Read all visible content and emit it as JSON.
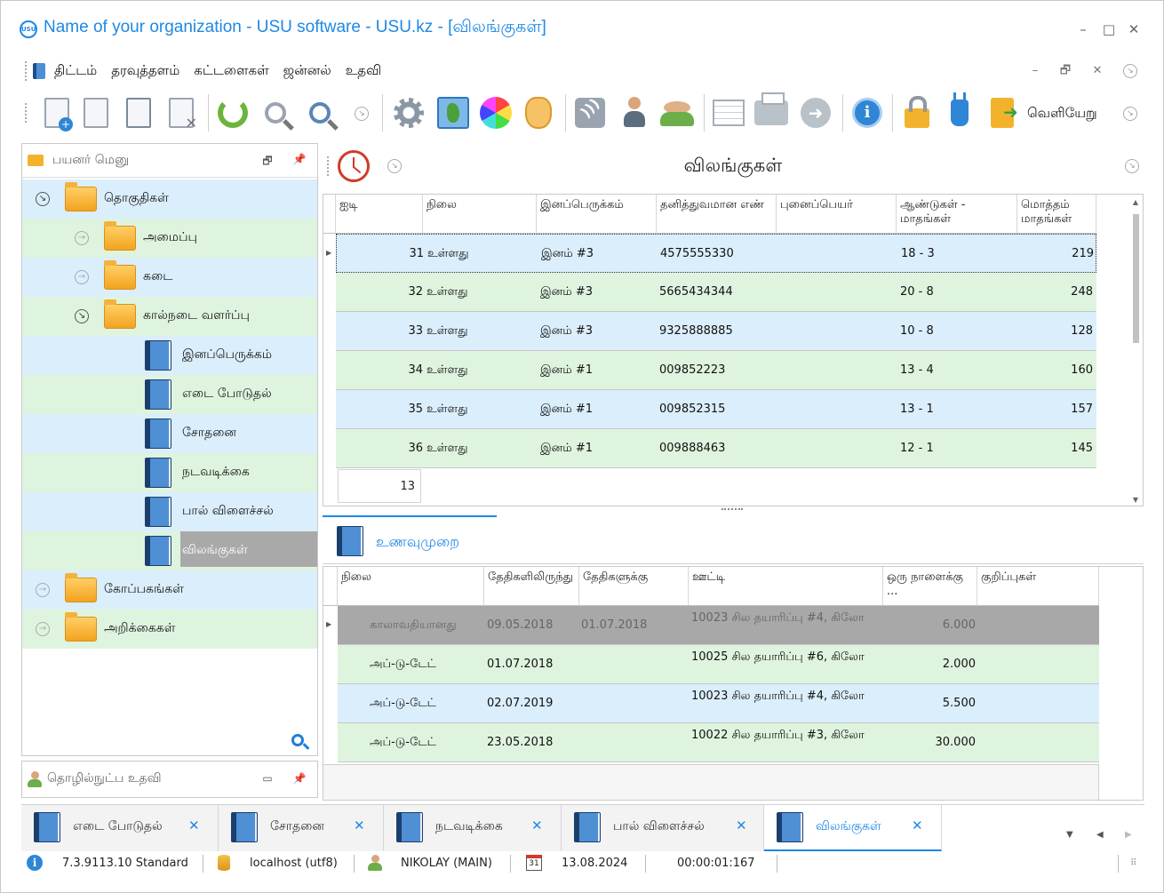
{
  "window": {
    "logo_text": "USU",
    "title": "Name of your organization - USU software - USU.kz - [விலங்குகள்]",
    "minimize": "–",
    "maximize": "□",
    "close": "✕"
  },
  "menu": {
    "items": [
      "திட்டம்",
      "தரவுத்தளம்",
      "கட்டளைகள்",
      "ஜன்னல்",
      "உதவி"
    ],
    "mdi_minimize": "–",
    "mdi_restore": "🗗",
    "mdi_close": "✕"
  },
  "toolbar": {
    "exit_label": "வெளியேறு",
    "icons": [
      "new-document-icon",
      "copy-document-icon",
      "edit-document-icon",
      "delete-document-icon",
      "refresh-icon",
      "search-icon",
      "advanced-search-icon",
      "settings-gear-icon",
      "map-icon",
      "color-wheel-icon",
      "hand-icon",
      "rss-icon",
      "user-key-icon",
      "users-group-icon",
      "table-grid-icon",
      "printer-icon",
      "forward-arrow-icon",
      "info-icon",
      "lock-icon",
      "plug-icon",
      "exit-door-icon"
    ]
  },
  "nav_panel": {
    "title": "பயனர் மெனு",
    "tree": [
      {
        "label": "தொகுதிகள்",
        "level": 0,
        "type": "folder",
        "expanded": true
      },
      {
        "label": "அமைப்பு",
        "level": 1,
        "type": "folder",
        "expanded": false
      },
      {
        "label": "கடை",
        "level": 1,
        "type": "folder",
        "expanded": false
      },
      {
        "label": "கால்நடை வளர்ப்பு",
        "level": 1,
        "type": "folder",
        "expanded": true
      },
      {
        "label": "இனப்பெருக்கம்",
        "level": 2,
        "type": "book"
      },
      {
        "label": "எடை போடுதல்",
        "level": 2,
        "type": "book"
      },
      {
        "label": "சோதனை",
        "level": 2,
        "type": "book"
      },
      {
        "label": "நடவடிக்கை",
        "level": 2,
        "type": "book"
      },
      {
        "label": "பால் விளைச்சல்",
        "level": 2,
        "type": "book"
      },
      {
        "label": "விலங்குகள்",
        "level": 2,
        "type": "book",
        "selected": true
      },
      {
        "label": "கோப்பகங்கள்",
        "level": 0,
        "type": "folder",
        "expanded": false
      },
      {
        "label": "அறிக்கைகள்",
        "level": 0,
        "type": "folder",
        "expanded": false
      }
    ]
  },
  "help_panel": {
    "title": "தொழில்நுட்ப உதவி"
  },
  "main": {
    "title": "விலங்குகள்",
    "columns": [
      "ஐடி",
      "நிலை",
      "இனப்பெருக்கம்",
      "தனித்துவமான எண்",
      "புனைப்பெயர்",
      "ஆண்டுகள் - மாதங்கள்",
      "மொத்தம் மாதங்கள்"
    ],
    "rows": [
      {
        "id": "31",
        "status": "உள்ளது",
        "breed": "இனம் #3",
        "number": "4575555330",
        "nickname": "",
        "age": "18 - 3",
        "total": "219"
      },
      {
        "id": "32",
        "status": "உள்ளது",
        "breed": "இனம் #3",
        "number": "5665434344",
        "nickname": "",
        "age": "20 - 8",
        "total": "248"
      },
      {
        "id": "33",
        "status": "உள்ளது",
        "breed": "இனம் #3",
        "number": "9325888885",
        "nickname": "",
        "age": "10 - 8",
        "total": "128"
      },
      {
        "id": "34",
        "status": "உள்ளது",
        "breed": "இனம் #1",
        "number": "009852223",
        "nickname": "",
        "age": "13 - 4",
        "total": "160"
      },
      {
        "id": "35",
        "status": "உள்ளது",
        "breed": "இனம் #1",
        "number": "009852315",
        "nickname": "",
        "age": "13 - 1",
        "total": "157"
      },
      {
        "id": "36",
        "status": "உள்ளது",
        "breed": "இனம் #1",
        "number": "009888463",
        "nickname": "",
        "age": "12 - 1",
        "total": "145"
      }
    ],
    "footer_count": "13"
  },
  "detail": {
    "tab_label": "உணவுமுறை",
    "columns": [
      "நிலை",
      "தேதிகளிலிருந்து",
      "தேதிகளுக்கு",
      "ஊட்டி",
      "ஒரு நாளைக்கு ...",
      "குறிப்புகள்"
    ],
    "rows": [
      {
        "status": "காலாவதியானது",
        "from": "09.05.2018",
        "to": "01.07.2018",
        "feed": "10023 சில தயாரிப்பு #4, கிலோ",
        "per_day": "6.000",
        "notes": ""
      },
      {
        "status": "அப்-டு-டேட்",
        "from": "01.07.2018",
        "to": "",
        "feed": "10025 சில தயாரிப்பு #6, கிலோ",
        "per_day": "2.000",
        "notes": ""
      },
      {
        "status": "அப்-டு-டேட்",
        "from": "02.07.2019",
        "to": "",
        "feed": "10023 சில தயாரிப்பு #4, கிலோ",
        "per_day": "5.500",
        "notes": ""
      },
      {
        "status": "அப்-டு-டேட்",
        "from": "23.05.2018",
        "to": "",
        "feed": "10022 சில தயாரிப்பு #3, கிலோ",
        "per_day": "30.000",
        "notes": ""
      }
    ]
  },
  "doc_tabs": [
    {
      "label": "எடை போடுதல்",
      "active": false
    },
    {
      "label": "சோதனை",
      "active": false
    },
    {
      "label": "நடவடிக்கை",
      "active": false
    },
    {
      "label": "பால் விளைச்சல்",
      "active": false
    },
    {
      "label": "விலங்குகள்",
      "active": true
    }
  ],
  "status_bar": {
    "version": "7.3.9113.10 Standard",
    "database": "localhost (utf8)",
    "user": "NIKOLAY (MAIN)",
    "calendar_day": "31",
    "date": "13.08.2024",
    "timer": "00:00:01:167"
  },
  "colors": {
    "accent": "#1e88e5",
    "row_blue": "#dbeefb",
    "row_green": "#dff4df",
    "row_selected_gray": "#a8a8a8"
  }
}
